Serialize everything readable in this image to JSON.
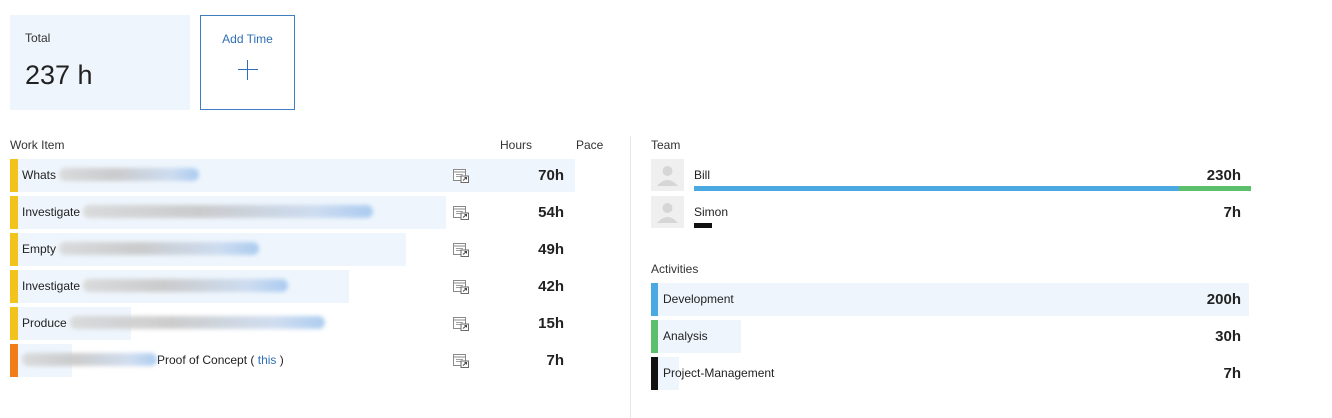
{
  "summary": {
    "total_label": "Total",
    "total_value": "237 h",
    "add_label": "Add Time"
  },
  "work_items": {
    "headers": {
      "item": "Work Item",
      "hours": "Hours",
      "pace": "Pace"
    },
    "rows": [
      {
        "prefix": "Whats",
        "suffix": "",
        "link": "",
        "hours": "70h",
        "stripe": "#f2c31a",
        "share": 1.0
      },
      {
        "prefix": "Investigate",
        "suffix": "",
        "link": "",
        "hours": "54h",
        "stripe": "#f2c31a",
        "share": 0.771
      },
      {
        "prefix": "Empty",
        "suffix": "",
        "link": "",
        "hours": "49h",
        "stripe": "#f2c31a",
        "share": 0.7
      },
      {
        "prefix": "Investigate",
        "suffix": "",
        "link": "",
        "hours": "42h",
        "stripe": "#f2c31a",
        "share": 0.6
      },
      {
        "prefix": "Produce",
        "suffix": "",
        "link": "",
        "hours": "15h",
        "stripe": "#f2c31a",
        "share": 0.214
      },
      {
        "prefix": "",
        "suffix": "Proof of Concept",
        "link": "this",
        "hours": "7h",
        "stripe": "#f07c1a",
        "share": 0.1
      }
    ]
  },
  "team": {
    "title": "Team",
    "members": [
      {
        "name": "Bill",
        "hours": "230h",
        "segments": [
          {
            "color": "#4aa9e0",
            "share": 0.87
          },
          {
            "color": "#5cbf6b",
            "share": 0.13
          }
        ]
      },
      {
        "name": "Simon",
        "hours": "7h",
        "segments": [
          {
            "color": "#111111",
            "share": 1.0
          }
        ]
      }
    ]
  },
  "activities": {
    "title": "Activities",
    "items": [
      {
        "name": "Development",
        "hours": "200h",
        "color": "#4aa9e0",
        "share": 1.0
      },
      {
        "name": "Analysis",
        "hours": "30h",
        "color": "#5cbf6b",
        "share": 0.15
      },
      {
        "name": "Project-Management",
        "hours": "7h",
        "color": "#111111",
        "share": 0.035
      }
    ]
  }
}
